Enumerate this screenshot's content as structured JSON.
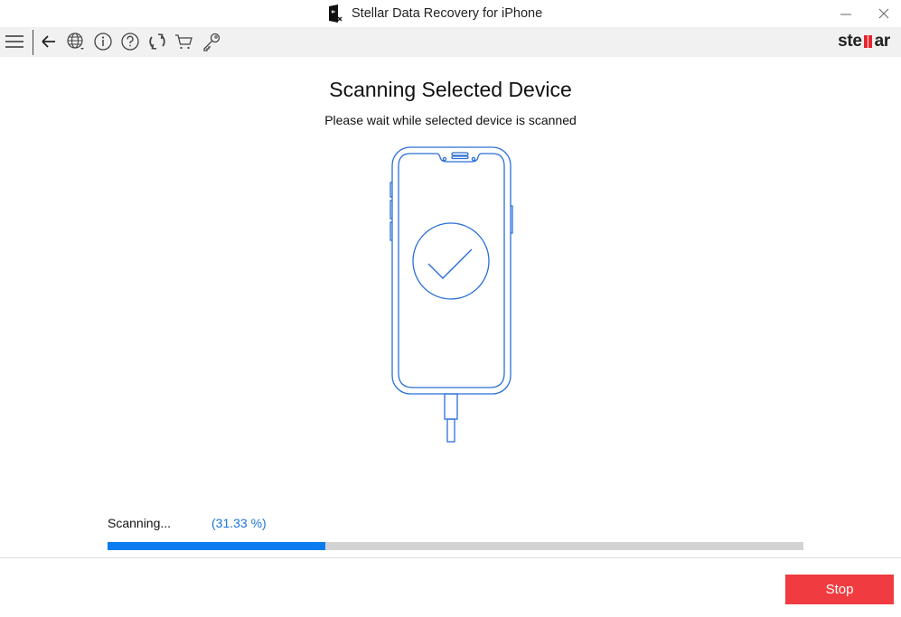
{
  "window": {
    "title": "Stellar Data Recovery for iPhone",
    "minimize_label": "—",
    "close_label": "✕"
  },
  "toolbar": {
    "icons": [
      "menu-icon",
      "back-icon",
      "language-icon",
      "info-icon",
      "help-icon",
      "update-icon",
      "cart-icon",
      "key-icon"
    ],
    "logo_prefix": "ste",
    "logo_suffix": "ar"
  },
  "main": {
    "title": "Scanning Selected Device",
    "subtitle": "Please wait while selected device is scanned"
  },
  "progress": {
    "status_label": "Scanning...",
    "percent_label": "(31.33 %)",
    "value_percent": 31.33,
    "fill_color": "#0a7cf0",
    "track_color": "#d3d3d3"
  },
  "footer": {
    "stop_label": "Stop",
    "stop_color": "#f03c40"
  }
}
